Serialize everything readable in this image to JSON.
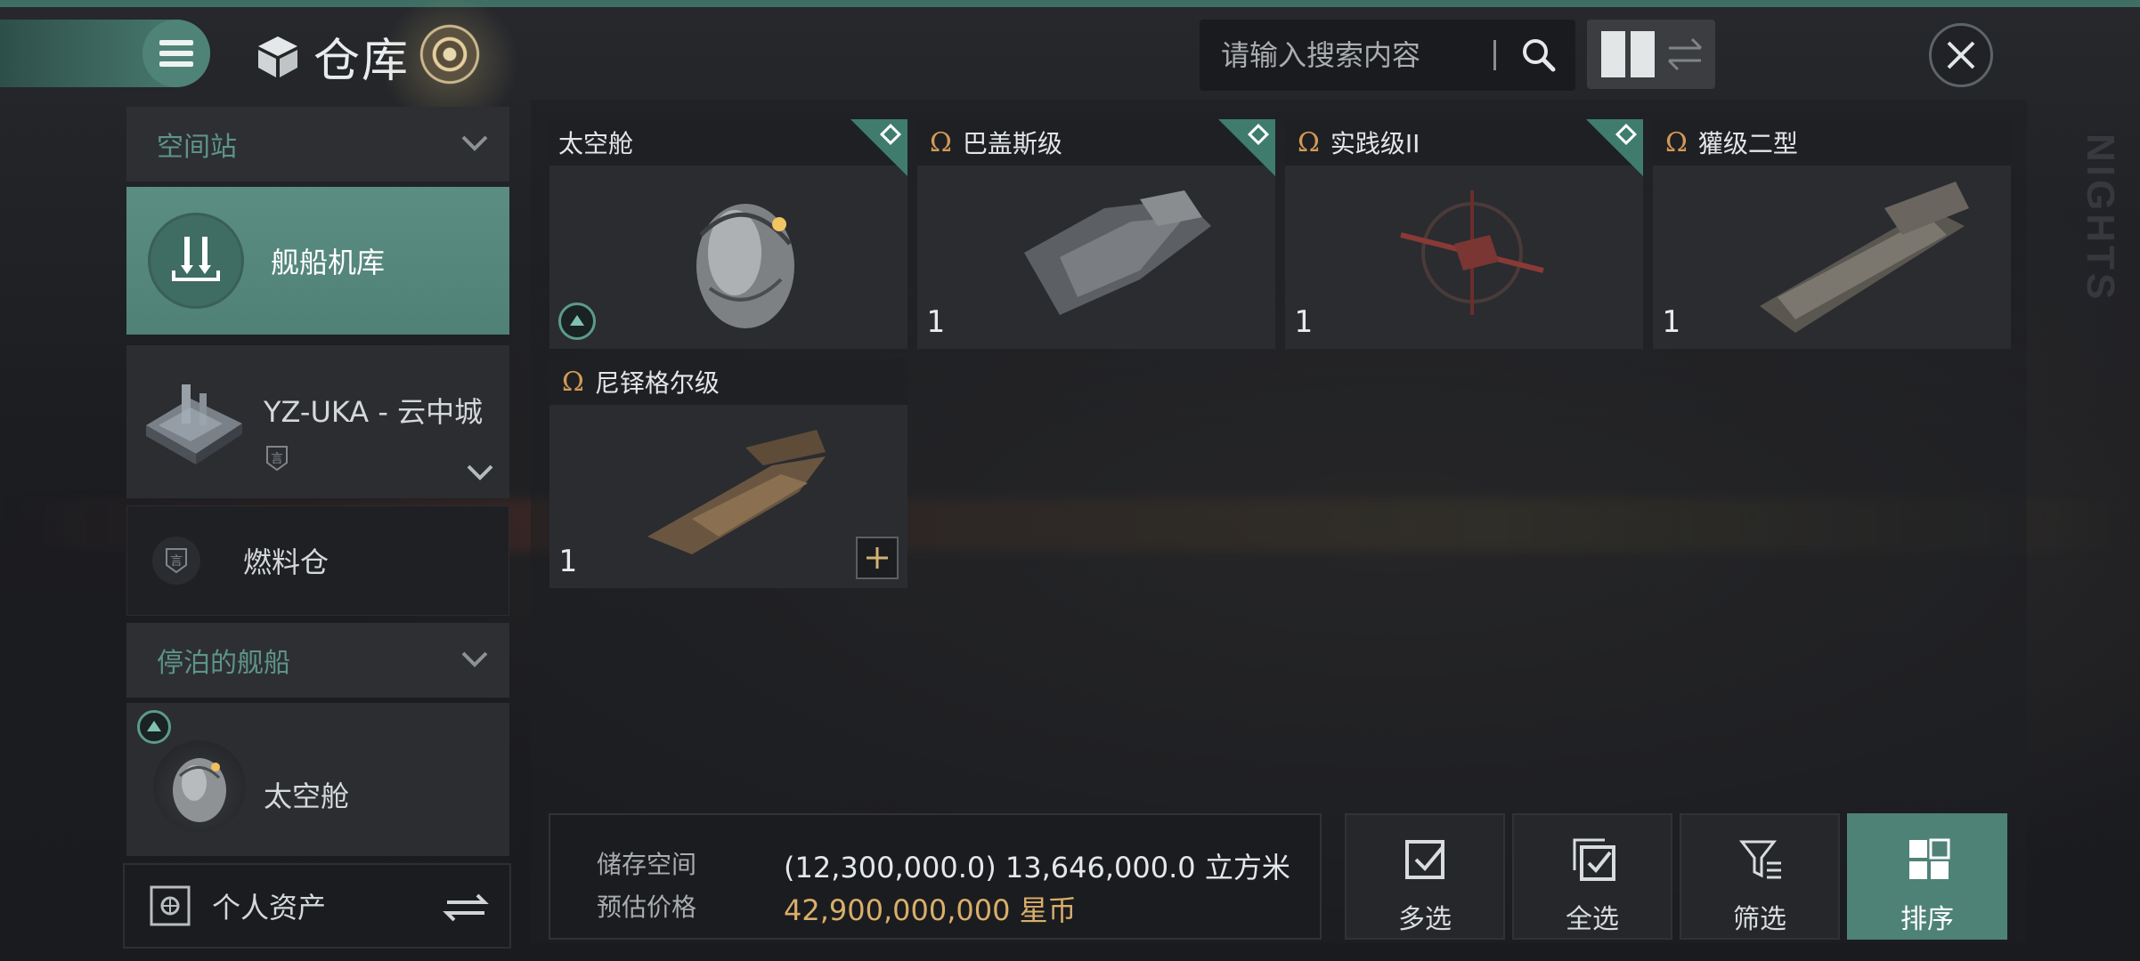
{
  "header": {
    "title": "仓库",
    "search_placeholder": "请输入搜索内容"
  },
  "sidebar": {
    "section_station": "空间站",
    "hangar_label": "舰船机库",
    "station_name": "YZ-UKA - 云中城",
    "fuel_label": "燃料仓",
    "section_docked": "停泊的舰船",
    "docked_ship": "太空舱",
    "assets_label": "个人资产"
  },
  "items": [
    {
      "name": "太空舱",
      "faction_icon": "",
      "quantity": "",
      "has_corner": true
    },
    {
      "name": "巴盖斯级",
      "faction_icon": "Ω",
      "quantity": "1",
      "has_corner": true
    },
    {
      "name": "实践级II",
      "faction_icon": "Ω",
      "quantity": "1",
      "has_corner": true
    },
    {
      "name": "獾级二型",
      "faction_icon": "Ω",
      "quantity": "1",
      "has_corner": false
    },
    {
      "name": "尼铎格尔级",
      "faction_icon": "Ω",
      "quantity": "1",
      "has_corner": false
    }
  ],
  "footer": {
    "storage_label": "储存空间",
    "storage_value": "(12,300,000.0) 13,646,000.0 立方米",
    "price_label": "预估价格",
    "price_value": "42,900,000,000 星币",
    "actions": [
      "多选",
      "全选",
      "筛选",
      "排序"
    ],
    "active_action": "排序"
  },
  "colors": {
    "accent": "#4f8277",
    "gold": "#d9ae6b",
    "faction": "#d29a56"
  }
}
